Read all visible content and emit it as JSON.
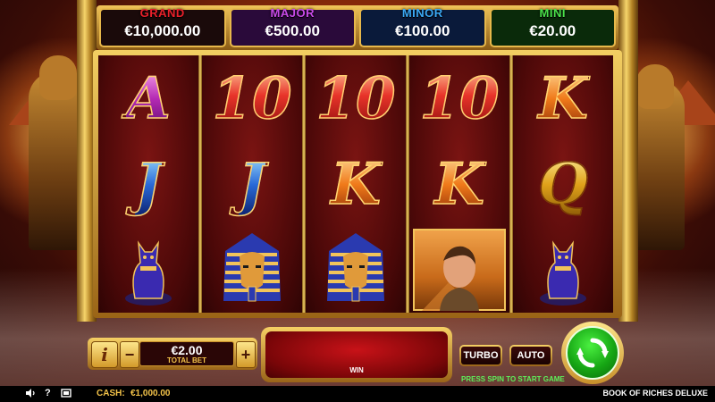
{
  "jackpots": [
    {
      "label": "GRAND",
      "value": "€10,000.00",
      "color": "#e8202a",
      "bg": "#1a0a0a"
    },
    {
      "label": "MAJOR",
      "value": "€500.00",
      "color": "#c84ae8",
      "bg": "#2a0a3a"
    },
    {
      "label": "MINOR",
      "value": "€100.00",
      "color": "#3aa8f4",
      "bg": "#0a1a3a"
    },
    {
      "label": "MINI",
      "value": "€20.00",
      "color": "#4ae04a",
      "bg": "#0a2a0a"
    }
  ],
  "reels": [
    [
      "A",
      "J",
      "cat"
    ],
    [
      "10",
      "J",
      "pharaoh"
    ],
    [
      "10",
      "K",
      "pharaoh"
    ],
    [
      "10",
      "K",
      "explorer"
    ],
    [
      "K",
      "Q",
      "cat"
    ]
  ],
  "bet": {
    "info_label": "i",
    "minus_label": "−",
    "plus_label": "+",
    "value": "€2.00",
    "label": "TOTAL BET"
  },
  "win": {
    "label": "WIN"
  },
  "buttons": {
    "turbo": "TURBO",
    "auto": "AUTO"
  },
  "hint": "PRESS SPIN TO START GAME",
  "status": {
    "cash_label": "CASH:",
    "cash_value": "€1,000.00",
    "game_title": "BOOK OF RICHES DELUXE"
  },
  "icons": {
    "sound": "speaker-icon",
    "help": "help-icon",
    "fullscreen": "fullscreen-icon",
    "spin": "spin-arrows-icon"
  }
}
